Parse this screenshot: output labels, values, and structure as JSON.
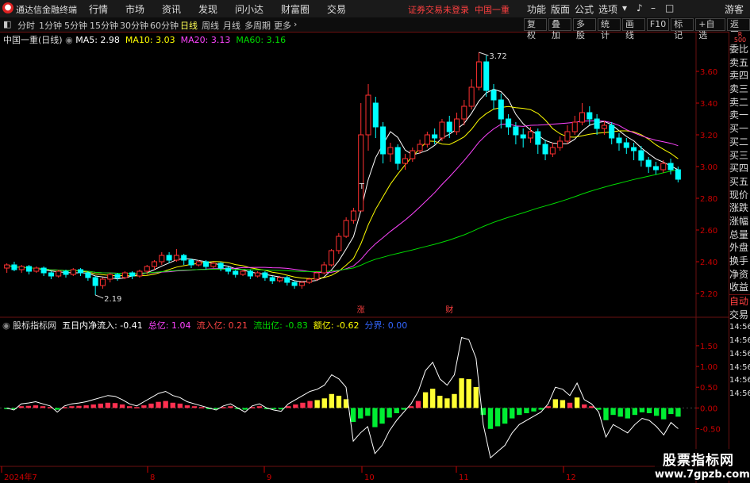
{
  "app": {
    "title": "通达信金融终端",
    "status": "证券交易未登录",
    "stock_name": "中国一重",
    "guest": "游客"
  },
  "menu": [
    "行情",
    "市场",
    "资讯",
    "发现",
    "问小达",
    "财富圈",
    "交易"
  ],
  "right_menu": [
    "功能",
    "版面",
    "公式",
    "选项"
  ],
  "periods": [
    "分时",
    "1分钟",
    "5分钟",
    "15分钟",
    "30分钟",
    "60分钟",
    "日线",
    "周线",
    "月线",
    "多周期",
    "更多"
  ],
  "active_period": "日线",
  "toolbar_right": [
    "复权",
    "叠加",
    "多股",
    "统计",
    "画线",
    "F10",
    "标记",
    "+自选",
    "返回"
  ],
  "quote_sidebar": [
    "委比",
    "卖五",
    "卖四",
    "卖三",
    "卖二",
    "卖一",
    "买一",
    "买二",
    "买三",
    "买四",
    "买五",
    "现价",
    "涨跌",
    "涨幅",
    "总量",
    "外盘",
    "换手",
    "净资",
    "收益",
    "自动",
    "交易"
  ],
  "time_labels": [
    "14:56",
    "14:56",
    "14:56",
    "14:56",
    "14:56",
    "14:56"
  ],
  "main_chart": {
    "title": "中国一重(日线)",
    "ma_labels": [
      {
        "text": "MA5: 2.98",
        "color": "#ffffff"
      },
      {
        "text": "MA10: 3.03",
        "color": "#ffff00"
      },
      {
        "text": "MA20: 3.13",
        "color": "#ff44ff"
      },
      {
        "text": "MA60: 3.16",
        "color": "#00dd00"
      }
    ],
    "y_ticks": [
      "3.60",
      "3.40",
      "3.20",
      "3.00",
      "2.80",
      "2.60",
      "2.40",
      "2.20"
    ],
    "high_label": "3.72",
    "low_label": "2.19",
    "marks": [
      "涨",
      "财",
      "T"
    ]
  },
  "indicator": {
    "name": "股标指标网",
    "params": [
      {
        "text": "五日内净流入: -0.41",
        "color": "#ffffff"
      },
      {
        "text": "总亿: 1.04",
        "color": "#ff44ff"
      },
      {
        "text": "流入亿: 0.21",
        "color": "#ff4040"
      },
      {
        "text": "流出亿: -0.83",
        "color": "#00dd00"
      },
      {
        "text": "额亿: -0.62",
        "color": "#ffff00"
      },
      {
        "text": "分界: 0.00",
        "color": "#3366ff"
      }
    ],
    "y_ticks": [
      "1.50",
      "1.00",
      "0.50",
      "0.00",
      "-0.50"
    ]
  },
  "x_labels": [
    "2024年7",
    "8",
    "9",
    "10",
    "11",
    "12"
  ],
  "watermark": {
    "line1": "股票指标网",
    "line2": "www.7gpzb.com"
  },
  "chart_data": {
    "type": "candlestick",
    "title": "中国一重(日线)",
    "ylim": [
      2.15,
      3.78
    ],
    "candles": [
      [
        2.36,
        2.38,
        2.33,
        2.39
      ],
      [
        2.38,
        2.35,
        2.34,
        2.4
      ],
      [
        2.35,
        2.37,
        2.33,
        2.38
      ],
      [
        2.37,
        2.34,
        2.32,
        2.38
      ],
      [
        2.34,
        2.36,
        2.33,
        2.37
      ],
      [
        2.36,
        2.33,
        2.31,
        2.37
      ],
      [
        2.33,
        2.31,
        2.29,
        2.34
      ],
      [
        2.31,
        2.34,
        2.3,
        2.35
      ],
      [
        2.34,
        2.32,
        2.3,
        2.35
      ],
      [
        2.32,
        2.35,
        2.31,
        2.36
      ],
      [
        2.35,
        2.33,
        2.31,
        2.36
      ],
      [
        2.33,
        2.3,
        2.28,
        2.34
      ],
      [
        2.3,
        2.25,
        2.19,
        2.31
      ],
      [
        2.25,
        2.29,
        2.23,
        2.3
      ],
      [
        2.29,
        2.32,
        2.27,
        2.33
      ],
      [
        2.32,
        2.3,
        2.28,
        2.33
      ],
      [
        2.3,
        2.33,
        2.29,
        2.34
      ],
      [
        2.33,
        2.31,
        2.29,
        2.34
      ],
      [
        2.31,
        2.34,
        2.3,
        2.35
      ],
      [
        2.34,
        2.37,
        2.32,
        2.38
      ],
      [
        2.37,
        2.4,
        2.35,
        2.41
      ],
      [
        2.4,
        2.44,
        2.38,
        2.46
      ],
      [
        2.44,
        2.41,
        2.39,
        2.46
      ],
      [
        2.41,
        2.44,
        2.4,
        2.48
      ],
      [
        2.44,
        2.41,
        2.38,
        2.45
      ],
      [
        2.41,
        2.38,
        2.36,
        2.42
      ],
      [
        2.38,
        2.4,
        2.37,
        2.41
      ],
      [
        2.4,
        2.37,
        2.35,
        2.41
      ],
      [
        2.37,
        2.39,
        2.36,
        2.4
      ],
      [
        2.39,
        2.36,
        2.34,
        2.4
      ],
      [
        2.36,
        2.34,
        2.32,
        2.37
      ],
      [
        2.34,
        2.32,
        2.3,
        2.35
      ],
      [
        2.32,
        2.34,
        2.31,
        2.35
      ],
      [
        2.34,
        2.31,
        2.29,
        2.35
      ],
      [
        2.31,
        2.33,
        2.3,
        2.34
      ],
      [
        2.33,
        2.3,
        2.28,
        2.34
      ],
      [
        2.3,
        2.28,
        2.26,
        2.31
      ],
      [
        2.28,
        2.3,
        2.27,
        2.31
      ],
      [
        2.3,
        2.27,
        2.25,
        2.31
      ],
      [
        2.27,
        2.25,
        2.23,
        2.28
      ],
      [
        2.25,
        2.27,
        2.23,
        2.28
      ],
      [
        2.27,
        2.29,
        2.26,
        2.3
      ],
      [
        2.29,
        2.33,
        2.28,
        2.34
      ],
      [
        2.33,
        2.38,
        2.32,
        2.4
      ],
      [
        2.38,
        2.47,
        2.37,
        2.48
      ],
      [
        2.47,
        2.56,
        2.45,
        2.58
      ],
      [
        2.56,
        2.66,
        2.55,
        2.68
      ],
      [
        2.66,
        2.72,
        2.64,
        2.74
      ],
      [
        2.72,
        3.2,
        2.9,
        3.4
      ],
      [
        3.2,
        3.45,
        3.1,
        3.52
      ],
      [
        3.4,
        3.25,
        3.18,
        3.44
      ],
      [
        3.25,
        3.08,
        3.02,
        3.28
      ],
      [
        3.08,
        3.12,
        3.03,
        3.15
      ],
      [
        3.12,
        3.02,
        2.98,
        3.14
      ],
      [
        3.02,
        3.05,
        2.98,
        3.08
      ],
      [
        3.05,
        3.1,
        3.03,
        3.12
      ],
      [
        3.1,
        3.14,
        3.08,
        3.17
      ],
      [
        3.14,
        3.2,
        3.12,
        3.22
      ],
      [
        3.2,
        3.18,
        3.14,
        3.24
      ],
      [
        3.18,
        3.28,
        3.16,
        3.3
      ],
      [
        3.28,
        3.22,
        3.18,
        3.32
      ],
      [
        3.22,
        3.3,
        3.2,
        3.34
      ],
      [
        3.3,
        3.38,
        3.26,
        3.42
      ],
      [
        3.38,
        3.5,
        3.36,
        3.55
      ],
      [
        3.5,
        3.66,
        3.48,
        3.72
      ],
      [
        3.66,
        3.48,
        3.44,
        3.7
      ],
      [
        3.48,
        3.42,
        3.36,
        3.52
      ],
      [
        3.42,
        3.3,
        3.24,
        3.46
      ],
      [
        3.3,
        3.25,
        3.2,
        3.33
      ],
      [
        3.25,
        3.2,
        3.14,
        3.28
      ],
      [
        3.2,
        3.18,
        3.12,
        3.24
      ],
      [
        3.18,
        3.22,
        3.15,
        3.25
      ],
      [
        3.22,
        3.14,
        3.08,
        3.24
      ],
      [
        3.14,
        3.08,
        3.04,
        3.17
      ],
      [
        3.08,
        3.12,
        3.06,
        3.15
      ],
      [
        3.12,
        3.16,
        3.1,
        3.19
      ],
      [
        3.16,
        3.22,
        3.14,
        3.26
      ],
      [
        3.22,
        3.28,
        3.2,
        3.32
      ],
      [
        3.28,
        3.34,
        3.26,
        3.4
      ],
      [
        3.34,
        3.3,
        3.26,
        3.38
      ],
      [
        3.3,
        3.24,
        3.2,
        3.33
      ],
      [
        3.24,
        3.26,
        3.2,
        3.29
      ],
      [
        3.26,
        3.18,
        3.14,
        3.28
      ],
      [
        3.18,
        3.15,
        3.1,
        3.21
      ],
      [
        3.15,
        3.12,
        3.08,
        3.18
      ],
      [
        3.12,
        3.1,
        3.04,
        3.15
      ],
      [
        3.1,
        3.04,
        3.0,
        3.13
      ],
      [
        3.04,
        3.0,
        2.96,
        3.06
      ],
      [
        3.0,
        2.98,
        2.95,
        3.03
      ],
      [
        2.98,
        3.02,
        2.96,
        3.04
      ],
      [
        3.02,
        2.98,
        2.95,
        3.05
      ],
      [
        2.98,
        2.92,
        2.9,
        3.0
      ]
    ],
    "indicator_values": [
      0.0,
      -0.05,
      0.1,
      0.12,
      0.15,
      0.1,
      0.05,
      -0.1,
      0.05,
      0.1,
      0.12,
      0.15,
      0.2,
      0.25,
      0.3,
      0.28,
      0.2,
      0.1,
      0.05,
      0.15,
      0.25,
      0.35,
      0.4,
      0.3,
      0.25,
      0.15,
      0.1,
      0.05,
      0.0,
      -0.05,
      0.05,
      0.1,
      0.0,
      -0.1,
      0.05,
      0.1,
      0.0,
      -0.05,
      -0.08,
      0.1,
      0.2,
      0.3,
      0.4,
      0.45,
      0.55,
      0.8,
      0.7,
      0.5,
      -0.8,
      -0.6,
      -0.45,
      -1.1,
      -0.9,
      -0.55,
      -0.3,
      -0.1,
      0.1,
      0.4,
      0.9,
      1.1,
      0.7,
      0.55,
      0.8,
      1.7,
      1.65,
      1.2,
      -0.4,
      -1.2,
      -1.05,
      -0.9,
      -0.6,
      -0.4,
      -0.3,
      -0.2,
      -0.1,
      0.1,
      0.5,
      0.45,
      0.3,
      0.6,
      0.2,
      0.1,
      -0.1,
      -0.7,
      -0.4,
      -0.5,
      -0.6,
      -0.4,
      -0.25,
      -0.3,
      -0.45,
      -0.65,
      -0.35,
      -0.5
    ]
  }
}
